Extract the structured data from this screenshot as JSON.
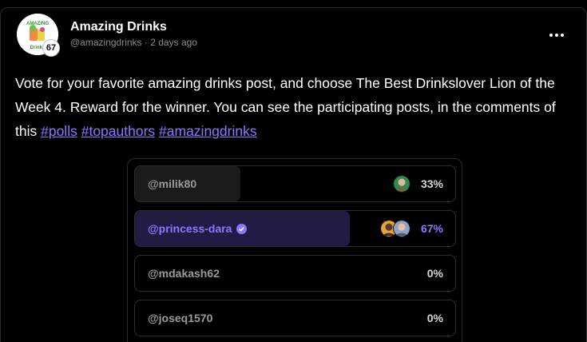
{
  "post": {
    "author_name": "Amazing Drinks",
    "handle": "@amazingdrinks",
    "separator": "·",
    "time_ago": "2 days ago",
    "level": "67",
    "avatar_logo_text": "AMAZING Drinks",
    "body_text": "Vote for your favorite amazing drinks post, and choose The Best Drinkslover Lion of the Week 4. Reward for the winner. You can see the participating posts, in the comments of this ",
    "tags": [
      "#polls",
      "#topauthors",
      "#amazingdrinks"
    ]
  },
  "poll": {
    "options": [
      {
        "label": "@milik80",
        "percent": "33%",
        "fraction": 0.33,
        "verified": false,
        "selected": false,
        "voter_icons": [
          "voter-avatar-1"
        ]
      },
      {
        "label": "@princess-dara",
        "percent": "67%",
        "fraction": 0.67,
        "verified": true,
        "selected": true,
        "voter_icons": [
          "voter-avatar-2",
          "voter-avatar-3"
        ]
      },
      {
        "label": "@mdakash62",
        "percent": "0%",
        "fraction": 0,
        "verified": false,
        "selected": false,
        "voter_icons": []
      },
      {
        "label": "@joseq1570",
        "percent": "0%",
        "fraction": 0,
        "verified": false,
        "selected": false,
        "voter_icons": []
      }
    ]
  },
  "colors": {
    "background": "#000000",
    "accent": "#8b78ff",
    "selected_fill": "#221c45",
    "unselected_fill": "#1b1b1b",
    "verified": "#8b78ff"
  },
  "icons": {
    "menu": "more-dots-icon",
    "verified": "verified-check-icon"
  }
}
